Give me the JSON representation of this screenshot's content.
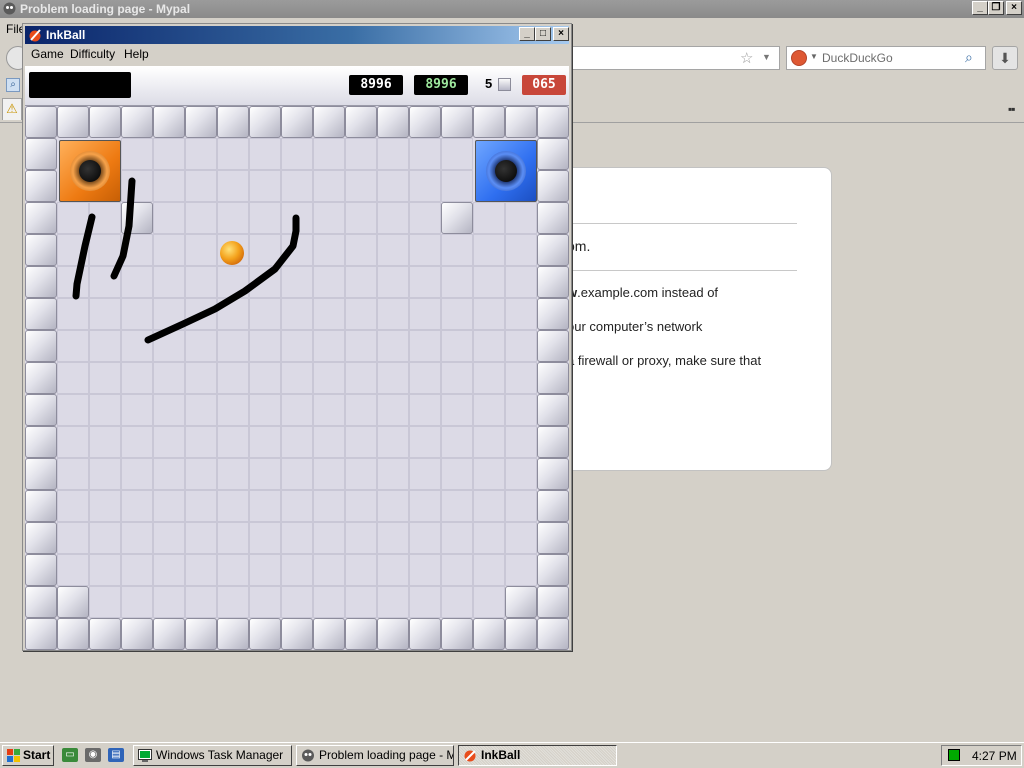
{
  "browser": {
    "title": "Problem loading page - Mypal",
    "menu_file": "File",
    "search_placeholder": "DuckDuckGo",
    "error_text": {
      "line1": "om.",
      "line2_bold": "w",
      "line2_rest": ".example.com instead of",
      "line3": "our computer’s network",
      "line4": "a firewall or proxy, make sure that"
    }
  },
  "inkball": {
    "title": "InkBall",
    "menu": [
      "Game",
      "Difficulty",
      "Help"
    ],
    "scores": {
      "score": "8996",
      "high_score": "8996"
    },
    "balls_remaining": "5",
    "timer": "065",
    "colors": {
      "orange_hole": "#ee7a12",
      "blue_hole": "#2f6ff0",
      "ball": "#f4a21c",
      "ink": "#000000",
      "timer_bg": "#c8473a"
    }
  },
  "taskbar": {
    "start": "Start",
    "tasks": [
      "Windows Task Manager",
      "Problem loading page - M...",
      "InkBall"
    ],
    "clock": "4:27 PM"
  }
}
